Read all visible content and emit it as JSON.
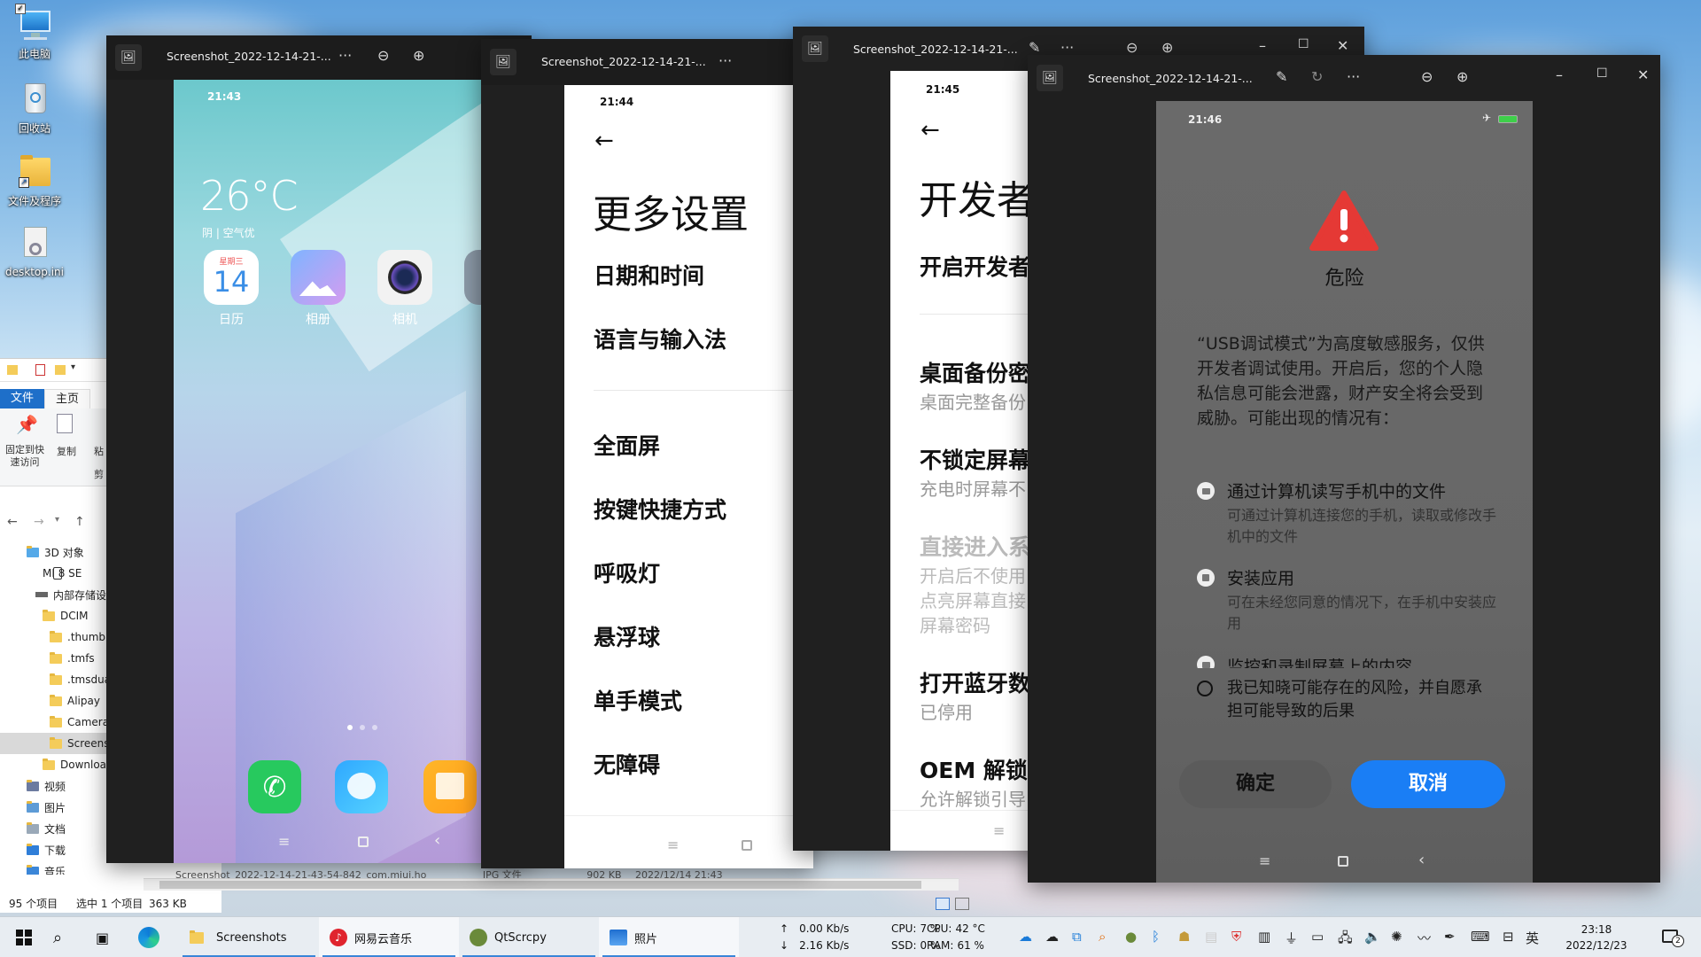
{
  "desktop": {
    "icons": [
      {
        "label": "此电脑",
        "icon": "computer-icon"
      },
      {
        "label": "回收站",
        "icon": "recycle-bin-icon"
      },
      {
        "label": "文件及程序",
        "icon": "folder-icon"
      },
      {
        "label": "desktop.ini",
        "icon": "settings-file-icon"
      }
    ]
  },
  "explorer": {
    "ribbon_tabs": [
      "文件",
      "主页"
    ],
    "ribbon_buttons": [
      "固定到快速访问",
      "复制",
      "粘",
      "剪"
    ],
    "tree": [
      {
        "label": "3D 对象",
        "indent": 1
      },
      {
        "label": "MI 8 SE",
        "indent": 1
      },
      {
        "label": "内部存储设",
        "indent": 2
      },
      {
        "label": "DCIM",
        "indent": 3
      },
      {
        "label": ".thumbn",
        "indent": 4
      },
      {
        "label": ".tmfs",
        "indent": 4
      },
      {
        "label": ".tmsdua",
        "indent": 4
      },
      {
        "label": "Alipay",
        "indent": 4
      },
      {
        "label": "Camera",
        "indent": 4
      },
      {
        "label": "Screens",
        "indent": 4
      },
      {
        "label": "Downloac",
        "indent": 3
      },
      {
        "label": "视频",
        "indent": 1
      },
      {
        "label": "图片",
        "indent": 1
      },
      {
        "label": "文档",
        "indent": 1
      },
      {
        "label": "下载",
        "indent": 1
      },
      {
        "label": "音乐",
        "indent": 1
      }
    ],
    "status": {
      "count": "95 个项目",
      "selected": "选中 1 个项目",
      "size": "363 KB"
    },
    "list_row": {
      "name": "Screenshot_2022-12-14-21-43-54-842_com.miui.ho",
      "type": "JPG 文件",
      "size": "902 KB",
      "date": "2022/12/14 21:43"
    }
  },
  "windows": [
    {
      "title": "Screenshot_2022-12-14-21-...",
      "phone": {
        "time": "21:43",
        "temperature": "26°C",
        "weather": "阴 | 空气优",
        "calendar_weekday": "星期三",
        "calendar_day": "14",
        "apps": [
          "日历",
          "相册",
          "相机"
        ]
      }
    },
    {
      "title": "Screenshot_2022-12-14-21-...",
      "phone": {
        "time": "21:44",
        "heading": "更多设置",
        "items": [
          "日期和时间",
          "语言与输入法",
          "全面屏",
          "按键快捷方式",
          "呼吸灯",
          "悬浮球",
          "单手模式",
          "无障碍"
        ]
      }
    },
    {
      "title": "Screenshot_2022-12-14-21-...",
      "phone": {
        "time": "21:45",
        "heading": "开发者",
        "items": [
          {
            "title": "开启开发者",
            "sub": ""
          },
          {
            "title": "桌面备份密",
            "sub": "桌面完整备份"
          },
          {
            "title": "不锁定屏幕",
            "sub": "充电时屏幕不"
          },
          {
            "title": "直接进入系",
            "sub": "开启后不使用"
          },
          {
            "title": "打开蓝牙数",
            "sub": "已停用"
          },
          {
            "title": "OEM 解锁",
            "sub": "允许解锁引导"
          }
        ],
        "disabled_sub2": "点亮屏幕直接",
        "disabled_sub3": "屏幕密码"
      }
    },
    {
      "title": "Screenshot_2022-12-14-21-...",
      "phone": {
        "time": "21:46",
        "dialog_title": "危险",
        "dialog_text": "“USB调试模式”为高度敏感服务，仅供开发者调试使用。开启后，您的个人隐私信息可能会泄露，财产安全将会受到威胁。可能出现的情况有：",
        "risks": [
          {
            "title": "通过计算机读写手机中的文件",
            "desc": "可通过计算机连接您的手机，读取或修改手机中的文件"
          },
          {
            "title": "安装应用",
            "desc": "可在未经您同意的情况下，在手机中安装应用"
          },
          {
            "title": "监控和录制屏幕上的内容",
            "desc": ""
          }
        ],
        "consent": "我已知晓可能存在的风险，并自愿承担可能导致的后果",
        "confirm": "确定",
        "cancel": "取消"
      }
    }
  ],
  "taskbar": {
    "apps": [
      {
        "label": "Screenshots",
        "icon": "folder-icon"
      },
      {
        "label": "网易云音乐",
        "icon": "netease-music-icon"
      },
      {
        "label": "QtScrcpy",
        "icon": "qtscrcpy-icon"
      },
      {
        "label": "照片",
        "icon": "photos-icon"
      }
    ],
    "monitor": {
      "up": "0.00 Kb/s",
      "down": "2.16 Kb/s",
      "cpu_label": "CPU:",
      "cpu": "7 %",
      "cpu_temp_label": "CPU:",
      "cpu_temp": "42 °C",
      "ssd_label": "SSD:",
      "ssd": "0 %",
      "ram_label": "RAM:",
      "ram": "61 %"
    },
    "ime": "英",
    "time": "23:18",
    "date": "2022/12/23",
    "notification_count": "2"
  },
  "colors": {
    "danger": "#e53935",
    "cancel_btn": "#1a7ef5",
    "taskbar": "#e8edf2"
  }
}
